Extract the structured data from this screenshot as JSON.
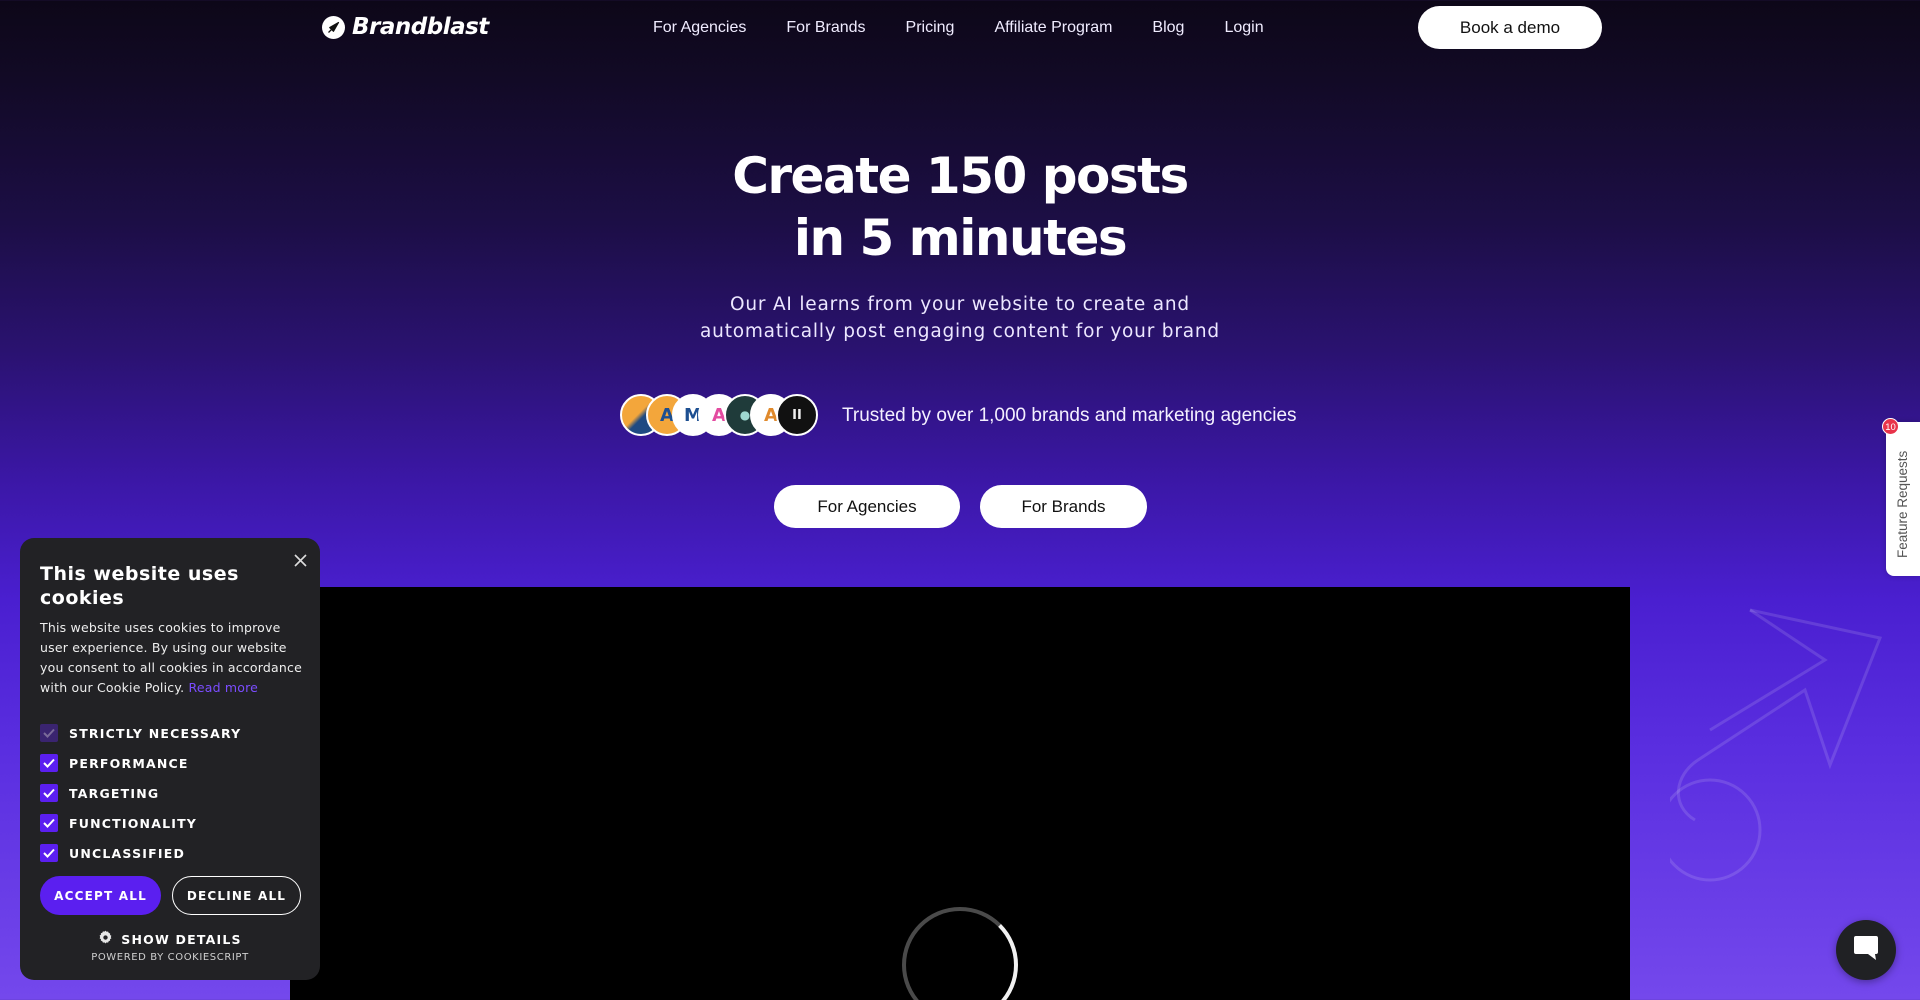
{
  "nav": {
    "logo_text": "Brandblast",
    "links": [
      "For Agencies",
      "For Brands",
      "Pricing",
      "Affiliate Program",
      "Blog",
      "Login"
    ],
    "demo_button": "Book a demo"
  },
  "hero": {
    "title_line1": "Create 150 posts",
    "title_line2": "in 5 minutes",
    "subtitle_line1": "Our AI learns from your website to create and",
    "subtitle_line2": "automatically post engaging content for your brand",
    "trust_text": "Trusted by over 1,000 brands and marketing agencies",
    "cta_agencies": "For Agencies",
    "cta_brands": "For Brands"
  },
  "feature_tab": {
    "label": "Feature Requests",
    "badge_count": "10"
  },
  "cookie": {
    "title": "This website uses cookies",
    "body": "This website uses cookies to improve user experience. By using our website you consent to all cookies in accordance with our Cookie Policy.",
    "read_more": "Read more",
    "options": [
      {
        "label": "STRICTLY NECESSARY",
        "checked": true,
        "disabled": true
      },
      {
        "label": "PERFORMANCE",
        "checked": true,
        "disabled": false
      },
      {
        "label": "TARGETING",
        "checked": true,
        "disabled": false
      },
      {
        "label": "FUNCTIONALITY",
        "checked": true,
        "disabled": false
      },
      {
        "label": "UNCLASSIFIED",
        "checked": true,
        "disabled": false
      }
    ],
    "accept_all": "ACCEPT ALL",
    "decline_all": "DECLINE ALL",
    "show_details": "SHOW DETAILS",
    "powered_by": "POWERED BY COOKIESCRIPT"
  },
  "colors": {
    "accent": "#5b1ff0",
    "panel_bg": "#222225",
    "badge": "#e8334a"
  },
  "icons": {
    "logo": "rocket-icon",
    "close": "close-icon",
    "settings": "gear-icon",
    "chat": "chat-icon"
  }
}
